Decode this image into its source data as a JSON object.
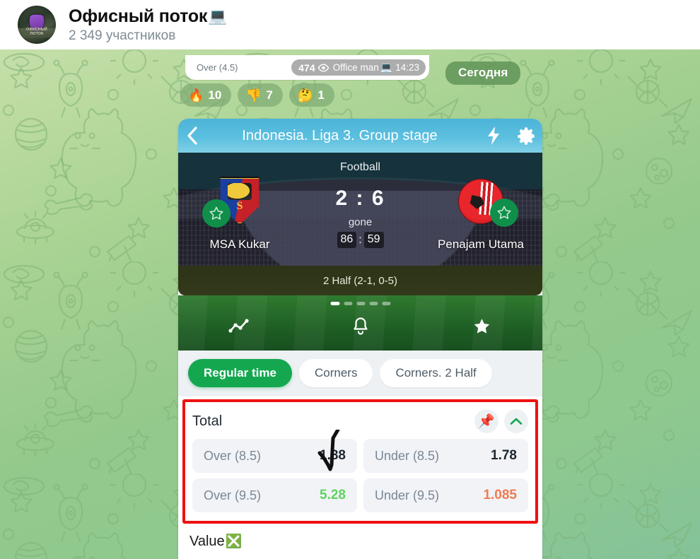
{
  "header": {
    "chat_title": "Офисный поток",
    "chat_title_emoji": "💻",
    "members": "2 349 участников",
    "avatar_line1": "ОФИСНЫЙ",
    "avatar_line2": "ПОТОК"
  },
  "message": {
    "cut_off_label": "Over (4.5)",
    "views": "474",
    "author": "Office man",
    "author_emoji": "💻",
    "time": "14:23",
    "date_divider": "Сегодня",
    "reactions": [
      {
        "emoji": "🔥",
        "count": "10"
      },
      {
        "emoji": "👎",
        "count": "7"
      },
      {
        "emoji": "🤔",
        "count": "1"
      }
    ]
  },
  "app": {
    "toolbar": {
      "back_icon": "chevron-left-icon",
      "title": "Indonesia. Liga 3. Group stage",
      "lightning_icon": "lightning-bolt-icon",
      "settings_icon": "gear-icon"
    },
    "scoreboard": {
      "sport": "Football",
      "score": "2 : 6",
      "status": "gone",
      "clock_minutes": "86",
      "clock_seconds": "59",
      "clock_colon": ":",
      "home_team": "MSA Kukar",
      "away_team": "Penajam Utama",
      "period_info": "2 Half (2-1, 0-5)",
      "slides_total": 5,
      "slide_active": 1
    },
    "pitch_actions": [
      {
        "icon": "statistics-chart-icon"
      },
      {
        "icon": "bell-icon"
      },
      {
        "icon": "star-icon"
      }
    ],
    "tabs": [
      {
        "label": "Regular time",
        "active": true
      },
      {
        "label": "Corners",
        "active": false
      },
      {
        "label": "Corners. 2 Half",
        "active": false
      }
    ],
    "market": {
      "title": "Total",
      "pin_icon": "pushpin-icon",
      "collapse_icon": "chevron-up-icon",
      "odds": [
        {
          "name": "Over (8.5)",
          "value": "1.88",
          "color": "default"
        },
        {
          "name": "Under (8.5)",
          "value": "1.78",
          "color": "default"
        },
        {
          "name": "Over (9.5)",
          "value": "5.28",
          "color": "green"
        },
        {
          "name": "Under (9.5)",
          "value": "1.085",
          "color": "orange"
        }
      ]
    },
    "value_section": {
      "label": "Value",
      "emoji": "❎"
    }
  },
  "colors": {
    "accent_green": "#15a750",
    "toolbar_blue": "#4cb4d8",
    "highlight_red": "#ee1111",
    "odd_green": "#5fd35f",
    "odd_orange": "#ef7b52"
  }
}
